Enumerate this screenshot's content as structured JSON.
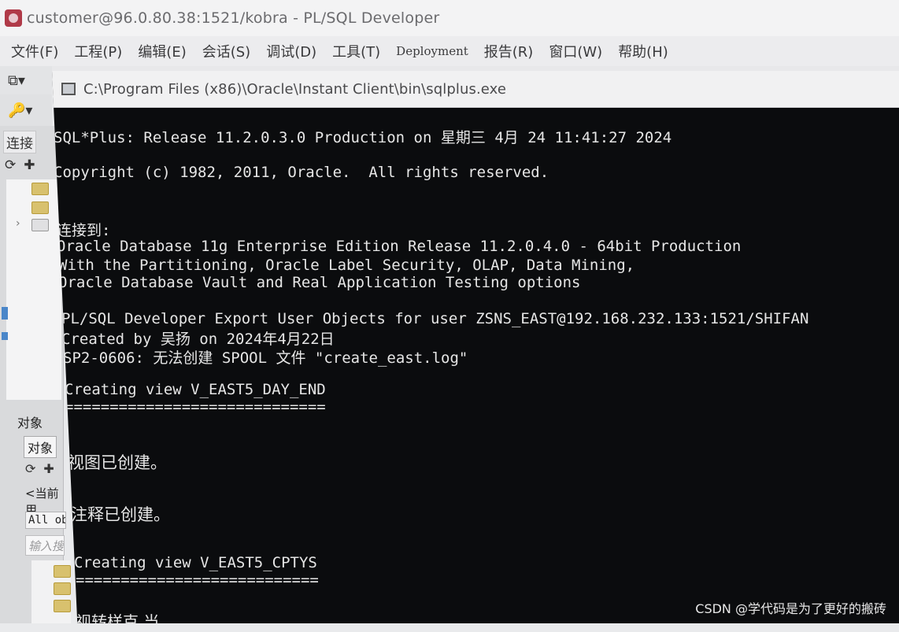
{
  "app": {
    "title": "customer@96.0.80.38:1521/kobra - PL/SQL Developer"
  },
  "menu": [
    "文件(F)",
    "工程(P)",
    "编辑(E)",
    "会话(S)",
    "调试(D)",
    "工具(T)",
    "Deployment",
    "报告(R)",
    "窗口(W)",
    "帮助(H)"
  ],
  "left_panel": {
    "connection_label": "连接",
    "objects_label": "对象",
    "objects_tab": "对象",
    "current_user": "<当前用",
    "all_objects": "All obj",
    "search_placeholder": "输入搜"
  },
  "console": {
    "title": "C:\\Program Files (x86)\\Oracle\\Instant Client\\bin\\sqlplus.exe",
    "lines": [
      "SQL*Plus: Release 11.2.0.3.0 Production on 星期三 4月 24 11:41:27 2024",
      "Copyright (c) 1982, 2011, Oracle.  All rights reserved.",
      "连接到:",
      "Oracle Database 11g Enterprise Edition Release 11.2.0.4.0 - 64bit Production",
      "With the Partitioning, Oracle Label Security, OLAP, Data Mining,",
      "Oracle Database Vault and Real Application Testing options",
      "PL/SQL Developer Export User Objects for user ZSNS_EAST@192.168.232.133:1521/SHIFAN",
      "Created by 吴扬 on 2024年4月22日",
      "SP2-0606: 无法创建 SPOOL 文件 \"create_east.log\"",
      "Creating view V_EAST5_DAY_END",
      "=============================",
      "视图已创建。",
      "注释已创建。",
      "Creating view V_EAST5_CPTYS",
      "===========================",
      "视转样克 当"
    ]
  },
  "watermark": "CSDN @学代码是为了更好的搬砖"
}
